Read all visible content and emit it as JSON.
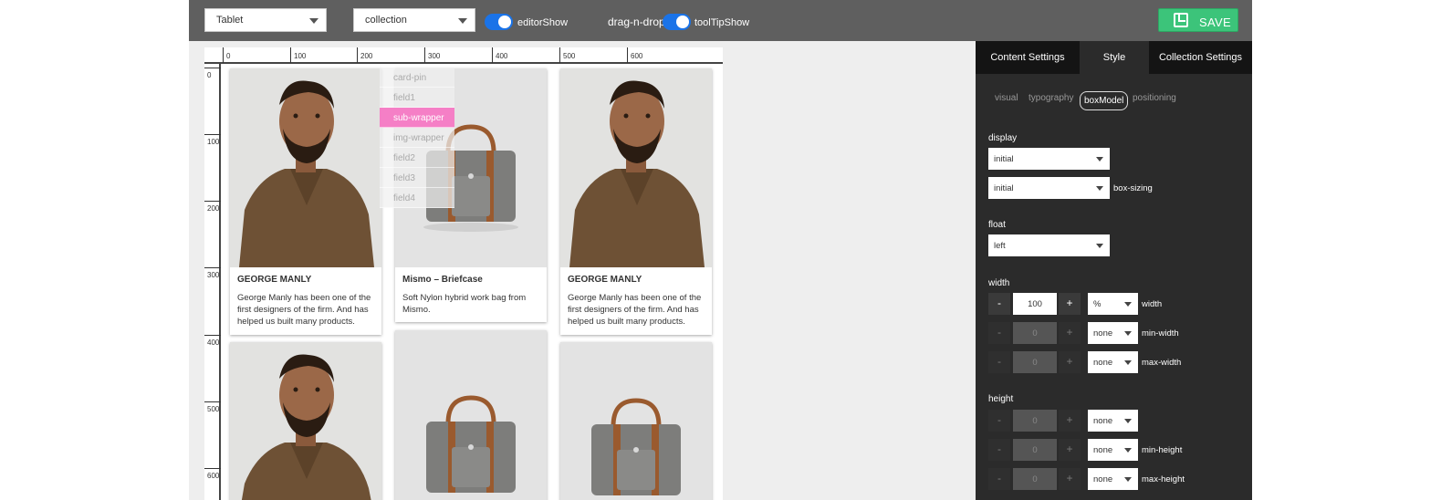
{
  "toolbar": {
    "device_select": "Tablet",
    "collection_select": "collection",
    "editor_toggle_label": "editorShow",
    "drag_label": "drag-n-drop",
    "tooltip_toggle_label": "toolTipShow",
    "save_label": "SAVE"
  },
  "ruler": {
    "x_ticks": [
      "0",
      "100",
      "200",
      "300",
      "400",
      "500",
      "600"
    ],
    "y_ticks": [
      "0",
      "100",
      "200",
      "300",
      "400",
      "500",
      "600"
    ]
  },
  "cards": [
    {
      "title": "GEORGE MANLY",
      "text": "George Manly has been one of the first designers of the firm. And has helped us built many products.",
      "image": "man"
    },
    {
      "title": "Mismo – Briefcase",
      "text": "Soft Nylon hybrid work bag from Mismo.",
      "image": "bag"
    },
    {
      "title": "GEORGE MANLY",
      "text": "George Manly has been one of the first designers of the firm. And has helped us built many products.",
      "image": "man"
    },
    {
      "title": "",
      "text": "",
      "image": "man"
    },
    {
      "title": "",
      "text": "",
      "image": "bag"
    },
    {
      "title": "",
      "text": "",
      "image": "bag"
    }
  ],
  "layer_menu": [
    "card-pin",
    "field1",
    "sub-wrapper",
    "img-wrapper",
    "field2",
    "field3",
    "field4"
  ],
  "panel": {
    "tabs": [
      "Content Settings",
      "Style",
      "Collection Settings"
    ],
    "subtabs": [
      "visual",
      "typography",
      "boxModel",
      "positioning"
    ],
    "display_label": "display",
    "display_value": "initial",
    "box_sizing_value": "initial",
    "box_sizing_label": "box-sizing",
    "float_label": "float",
    "float_value": "left",
    "width_label": "width",
    "width_rows": [
      {
        "minus": "-",
        "value": "100",
        "plus": "+",
        "unit": "%",
        "label": "width"
      },
      {
        "minus": "-",
        "value": "0",
        "plus": "+",
        "unit": "none",
        "label": "min-width"
      },
      {
        "minus": "-",
        "value": "0",
        "plus": "+",
        "unit": "none",
        "label": "max-width"
      }
    ],
    "height_label": "height",
    "height_rows": [
      {
        "minus": "-",
        "value": "0",
        "plus": "+",
        "unit": "none",
        "label": ""
      },
      {
        "minus": "-",
        "value": "0",
        "plus": "+",
        "unit": "none",
        "label": "min-height"
      },
      {
        "minus": "-",
        "value": "0",
        "plus": "+",
        "unit": "none",
        "label": "max-height"
      }
    ]
  },
  "colors": {
    "toolbar": "#5f5f5f",
    "save": "#3cc47a",
    "toggle": "#1a73e8",
    "active_layer": "#f57fc6",
    "panel": "#2b2b2b"
  }
}
